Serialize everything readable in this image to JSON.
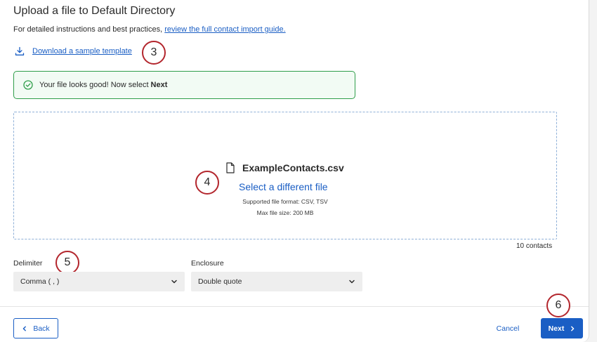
{
  "dialog": {
    "title": "Upload a file to Default Directory",
    "instructions_prefix": "For detailed instructions and best practices, ",
    "instructions_link": "review the full contact import guide."
  },
  "download": {
    "label": "Download a sample template",
    "icon": "download-icon"
  },
  "success_message": {
    "text": "Your file looks good! Now select",
    "bold": "Next",
    "icon": "check-circle-icon",
    "color": "#2f9e4a"
  },
  "dropzone": {
    "file_name": "ExampleContacts.csv",
    "file_icon": "file-icon",
    "select_link": "Select a different file",
    "supported_formats": "Supported file format: CSV, TSV",
    "max_size": "Max file size: 200 MB"
  },
  "contacts_count": "10 contacts",
  "delimiter": {
    "label": "Delimiter",
    "value": "Comma ( , )"
  },
  "enclosure": {
    "label": "Enclosure",
    "value": "Double quote"
  },
  "footer": {
    "back_label": "Back",
    "cancel_label": "Cancel",
    "next_label": "Next"
  },
  "callouts": [
    "3",
    "4",
    "5",
    "6"
  ],
  "colors": {
    "accent": "#1a5ec4",
    "callout_ring": "#b3262d",
    "success_border": "#2f9e4a"
  }
}
